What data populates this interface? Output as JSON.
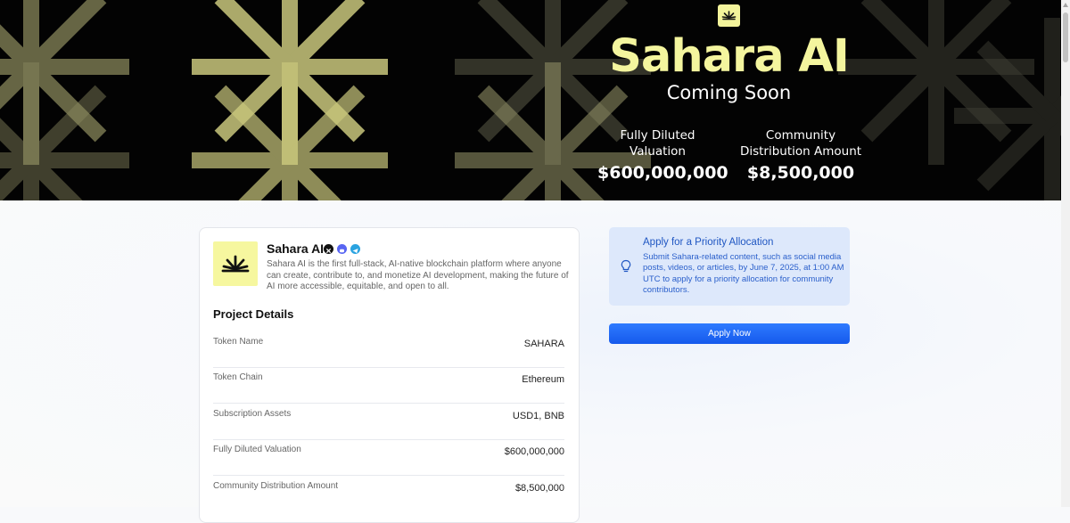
{
  "hero": {
    "title": "Sahara AI",
    "subtitle": "Coming Soon",
    "stats": [
      {
        "label": "Fully Diluted Valuation",
        "value": "$600,000,000"
      },
      {
        "label": "Community Distribution Amount",
        "value": "$8,500,000"
      }
    ]
  },
  "project": {
    "name": "Sahara AI",
    "description": "Sahara AI is the first full-stack, AI-native blockchain platform where anyone can create, contribute to, and monetize AI development, making the future of AI more accessible, equitable, and open to all.",
    "socials": [
      "x-icon",
      "discord-icon",
      "telegram-icon"
    ],
    "section_title": "Project Details",
    "details": [
      {
        "label": "Token Name",
        "value": "SAHARA"
      },
      {
        "label": "Token Chain",
        "value": "Ethereum"
      },
      {
        "label": "Subscription Assets",
        "value": "USD1, BNB"
      },
      {
        "label": "Fully Diluted Valuation",
        "value": "$600,000,000"
      },
      {
        "label": "Community Distribution Amount",
        "value": "$8,500,000"
      }
    ]
  },
  "priority": {
    "title": "Apply for a Priority Allocation",
    "body": "Submit Sahara-related content, such as social media posts, videos, or articles, by June 7, 2025, at 1:00 AM UTC to apply for a priority allocation for community contributors.",
    "button_label": "Apply Now"
  },
  "colors": {
    "accent_yellow": "#f4f59e",
    "hero_bg": "#030303",
    "primary_blue": "#1f6bff",
    "info_bg": "#dde8fb"
  }
}
